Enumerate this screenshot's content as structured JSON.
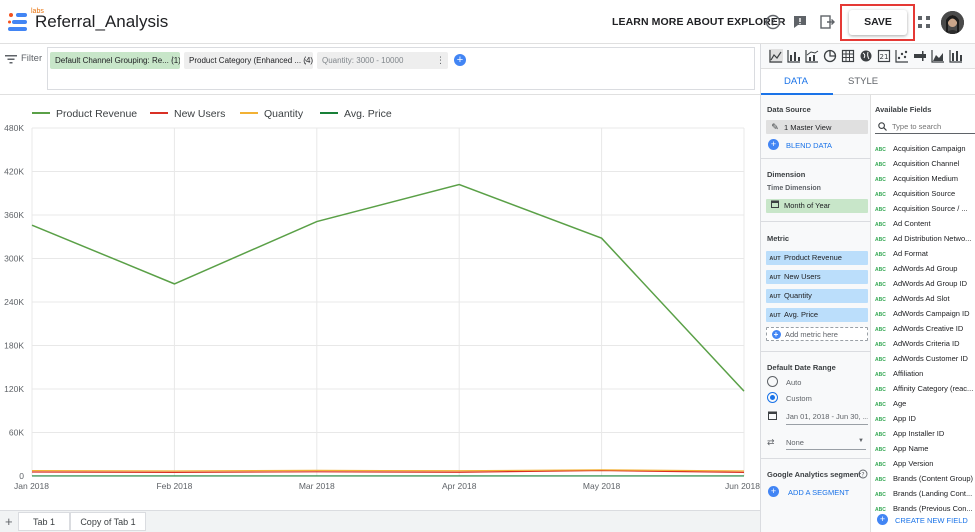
{
  "header": {
    "labs": "labs",
    "title": "Referral_Analysis",
    "learn_more": "LEARN MORE ABOUT EXPLORER",
    "save_label": "SAVE"
  },
  "filter": {
    "label": "Filter",
    "chips": [
      {
        "label": "Default Channel Grouping: Re... (1)",
        "bg": "#c8e6c9"
      },
      {
        "label": "Product Category (Enhanced ... (4)",
        "bg": "#eeeeee"
      },
      {
        "label": "Quantity: 3000 - 10000",
        "bg": "#eeeeee"
      }
    ]
  },
  "chart_data": {
    "type": "line",
    "title": "",
    "xlabel": "",
    "ylabel": "",
    "categories": [
      "Jan 2018",
      "Feb 2018",
      "Mar 2018",
      "Apr 2018",
      "May 2018",
      "Jun 2018"
    ],
    "ylim": [
      0,
      480000
    ],
    "yticks": [
      0,
      60000,
      120000,
      180000,
      240000,
      300000,
      360000,
      420000,
      480000
    ],
    "ytick_labels": [
      "0",
      "60K",
      "120K",
      "180K",
      "240K",
      "300K",
      "360K",
      "420K",
      "480K"
    ],
    "grid": true,
    "legend_position": "top-left",
    "series": [
      {
        "name": "Product Revenue",
        "color": "#5aa047",
        "values": [
          346000,
          265000,
          351000,
          402000,
          328000,
          117000
        ]
      },
      {
        "name": "New Users",
        "color": "#d93025",
        "values": [
          5500,
          5000,
          5800,
          5200,
          7500,
          5000
        ]
      },
      {
        "name": "Quantity",
        "color": "#f2b134",
        "values": [
          7500,
          7000,
          7800,
          7200,
          8500,
          7000
        ]
      },
      {
        "name": "Avg. Price",
        "color": "#188038",
        "values": [
          70,
          80,
          70,
          75,
          80,
          70
        ]
      }
    ]
  },
  "tabs": [
    "Tab 1",
    "Copy of Tab 1"
  ],
  "panel": {
    "tabs": [
      "DATA",
      "STYLE"
    ],
    "data_source_title": "Data Source",
    "data_source": "1 Master View",
    "blend_data": "BLEND DATA",
    "dimension_title": "Dimension",
    "time_dimension_title": "Time Dimension",
    "time_dimension": "Month of Year",
    "metric_title": "Metric",
    "metric_tag": "AUT",
    "metrics": [
      "Product Revenue",
      "New Users",
      "Quantity",
      "Avg. Price"
    ],
    "add_metric": "Add metric here",
    "date_range_title": "Default Date Range",
    "date_auto": "Auto",
    "date_custom": "Custom",
    "date_range": "Jan 01, 2018 - Jun 30, ...",
    "comparison": "None",
    "segment_title": "Google Analytics segment",
    "add_segment": "ADD A SEGMENT",
    "available_fields_title": "Available Fields",
    "search_placeholder": "Type to search",
    "field_tag": "ABC",
    "available_fields": [
      "Acquisition Campaign",
      "Acquisition Channel",
      "Acquisition Medium",
      "Acquisition Source",
      "Acquisition Source / ...",
      "Ad Content",
      "Ad Distribution Netwo...",
      "Ad Format",
      "AdWords Ad Group",
      "AdWords Ad Group ID",
      "AdWords Ad Slot",
      "AdWords Campaign ID",
      "AdWords Creative ID",
      "AdWords Criteria ID",
      "AdWords Customer ID",
      "Affiliation",
      "Affinity Category (reac...",
      "Age",
      "App ID",
      "App Installer ID",
      "App Name",
      "App Version",
      "Brands (Content Group)",
      "Brands (Landing Cont...",
      "Brands (Previous Con..."
    ],
    "create_new_field": "CREATE NEW FIELD"
  }
}
